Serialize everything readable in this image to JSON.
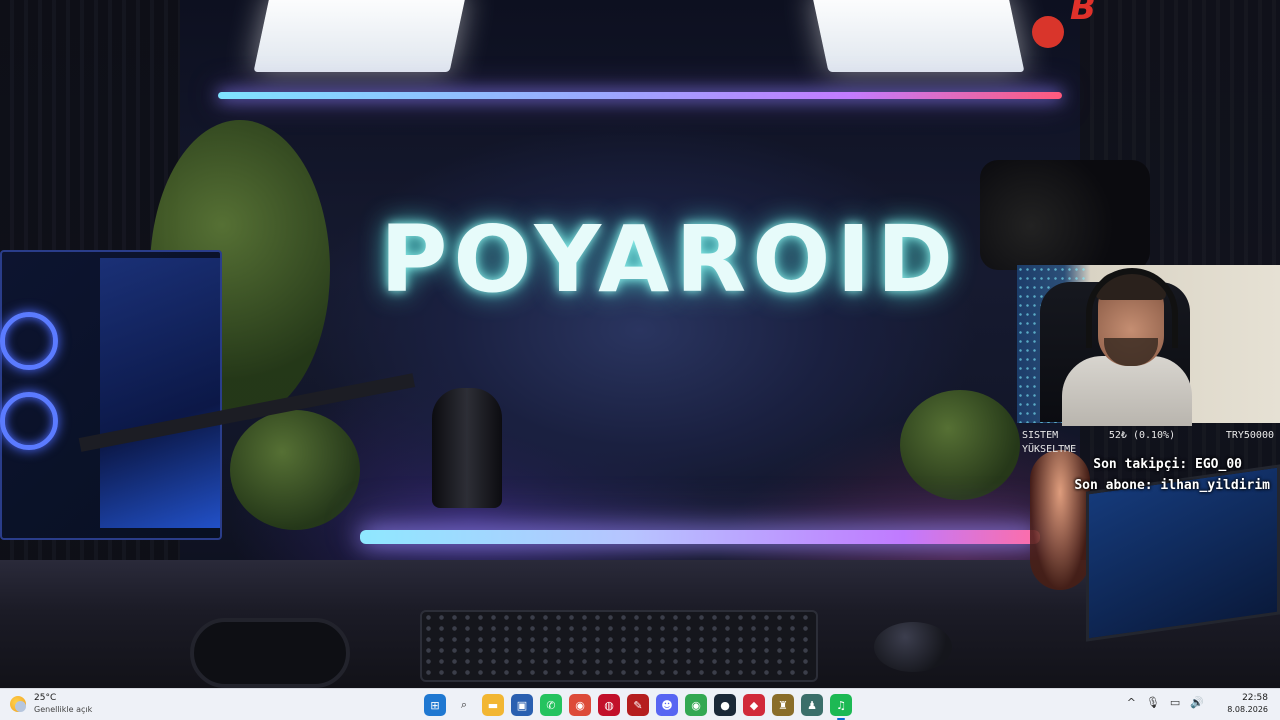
{
  "stream": {
    "channel_name": "POYAROID",
    "logo_text": "B",
    "overlay": {
      "system_label": "SISTEM",
      "upgrade_label": "YÜKSELTME",
      "progress_text": "52₺ (0.10%)",
      "goal_text": "TRY50000",
      "last_follower": "Son takipçi: EGO_00",
      "last_subscriber": "Son abone: ilhan_yildirim"
    }
  },
  "taskbar": {
    "weather": {
      "temperature": "25°C",
      "condition": "Genellikle açık"
    },
    "apps": [
      {
        "name": "start-icon",
        "glyph": "⊞",
        "color": "#1f78d1"
      },
      {
        "name": "search-icon",
        "glyph": "⌕",
        "color": "#333333"
      },
      {
        "name": "file-explorer-icon",
        "glyph": "▬",
        "color": "#f2b632"
      },
      {
        "name": "store-icon",
        "glyph": "▣",
        "color": "#2a5fb0"
      },
      {
        "name": "whatsapp-icon",
        "glyph": "✆",
        "color": "#25c35f"
      },
      {
        "name": "chrome-icon",
        "glyph": "◉",
        "color": "#dd4b39"
      },
      {
        "name": "opera-icon",
        "glyph": "◍",
        "color": "#c2102a"
      },
      {
        "name": "app-icon-red-feather",
        "glyph": "✎",
        "color": "#b51e1e"
      },
      {
        "name": "discord-icon",
        "glyph": "☻",
        "color": "#5865f2"
      },
      {
        "name": "chrome-alt-icon",
        "glyph": "◉",
        "color": "#33a852"
      },
      {
        "name": "steam-icon",
        "glyph": "●",
        "color": "#1b2838"
      },
      {
        "name": "app-icon-red",
        "glyph": "◆",
        "color": "#d12a3a"
      },
      {
        "name": "league-icon",
        "glyph": "♜",
        "color": "#8a6d2a"
      },
      {
        "name": "game-launcher-icon",
        "glyph": "♟",
        "color": "#3b6e6a"
      },
      {
        "name": "spotify-icon",
        "glyph": "♫",
        "color": "#1db954"
      }
    ],
    "tray": {
      "chevron": "^",
      "mic": "🎙",
      "network": "▭",
      "volume": "🔊"
    },
    "clock": {
      "time": "22:58",
      "date": "8.08.2026"
    }
  }
}
